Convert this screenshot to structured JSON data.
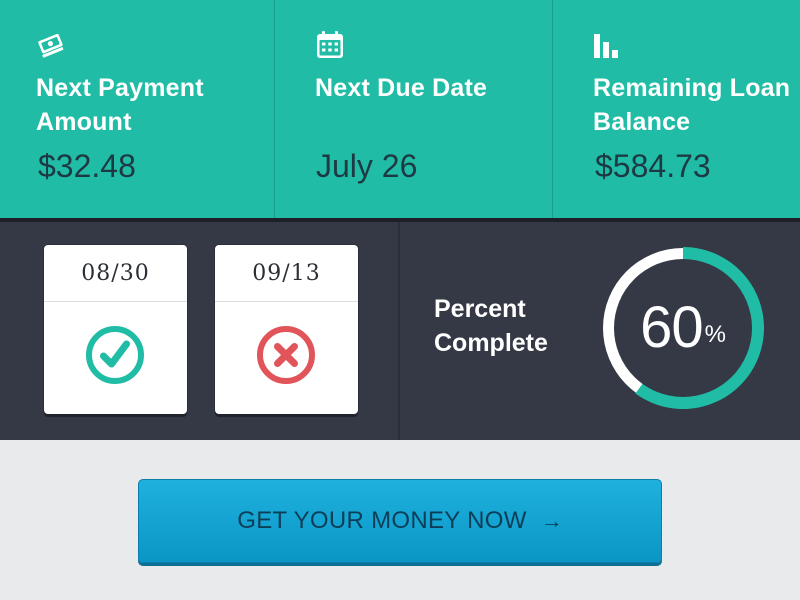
{
  "stats": [
    {
      "icon": "money-icon",
      "label": "Next Payment Amount",
      "value": "$32.48"
    },
    {
      "icon": "calendar-icon",
      "label": "Next Due Date",
      "value": "July 26"
    },
    {
      "icon": "bar-chart-icon",
      "label": "Remaining Loan Balance",
      "value": "$584.73"
    }
  ],
  "history": [
    {
      "date": "08/30",
      "status": "paid",
      "icon": "check-icon"
    },
    {
      "date": "09/13",
      "status": "missed",
      "icon": "cross-icon"
    }
  ],
  "progress": {
    "label": "Percent Complete",
    "value": "60",
    "unit": "%",
    "fraction": 0.6
  },
  "cta": {
    "label": "GET YOUR MONEY NOW",
    "arrow": "→"
  },
  "colors": {
    "teal": "#21bca5",
    "dark": "#343945",
    "red": "#e0545a",
    "blue": "#1aa6d4"
  }
}
